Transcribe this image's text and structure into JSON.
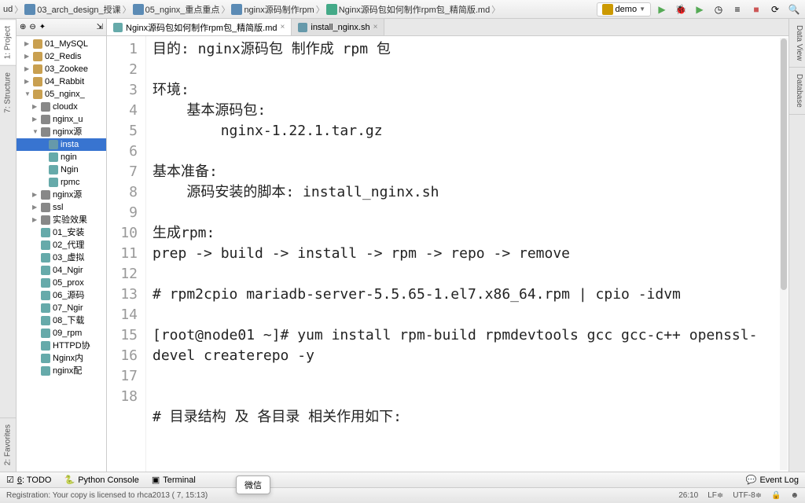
{
  "breadcrumb": [
    "ud",
    "03_arch_design_授课",
    "05_nginx_重点重点",
    "nginx源码制作rpm",
    "Nginx源码包如何制作rpm包_精简版.md"
  ],
  "run_config": "demo",
  "side_tabs": {
    "project": "1: Project",
    "structure": "7: Structure",
    "favorites": "2: Favorites"
  },
  "right_tabs": {
    "dataview": "Data View",
    "database": "Database"
  },
  "panel": {
    "header_icons": [
      "⊕",
      "⊖",
      "✦",
      "⇲"
    ]
  },
  "tree": [
    {
      "indent": 1,
      "arrow": "▶",
      "icon": "ti-folder",
      "label": "01_MySQL"
    },
    {
      "indent": 1,
      "arrow": "▶",
      "icon": "ti-folder",
      "label": "02_Redis"
    },
    {
      "indent": 1,
      "arrow": "▶",
      "icon": "ti-folder",
      "label": "03_Zookee"
    },
    {
      "indent": 1,
      "arrow": "▶",
      "icon": "ti-folder",
      "label": "04_Rabbit"
    },
    {
      "indent": 1,
      "arrow": "▼",
      "icon": "ti-folder",
      "label": "05_nginx_"
    },
    {
      "indent": 2,
      "arrow": "▶",
      "icon": "ti-folder-g",
      "label": "cloudx"
    },
    {
      "indent": 2,
      "arrow": "▶",
      "icon": "ti-folder-g",
      "label": "nginx_u"
    },
    {
      "indent": 2,
      "arrow": "▼",
      "icon": "ti-folder-g",
      "label": "nginx源"
    },
    {
      "indent": 3,
      "arrow": "",
      "icon": "ti-sh",
      "label": "insta",
      "sel": true
    },
    {
      "indent": 3,
      "arrow": "",
      "icon": "ti-md",
      "label": "ngin"
    },
    {
      "indent": 3,
      "arrow": "",
      "icon": "ti-md",
      "label": "Ngin"
    },
    {
      "indent": 3,
      "arrow": "",
      "icon": "ti-md",
      "label": "rpmc"
    },
    {
      "indent": 2,
      "arrow": "▶",
      "icon": "ti-folder-g",
      "label": "nginx源"
    },
    {
      "indent": 2,
      "arrow": "▶",
      "icon": "ti-folder-g",
      "label": "ssl"
    },
    {
      "indent": 2,
      "arrow": "▶",
      "icon": "ti-folder-g",
      "label": "实验效果"
    },
    {
      "indent": 2,
      "arrow": "",
      "icon": "ti-md",
      "label": "01_安装"
    },
    {
      "indent": 2,
      "arrow": "",
      "icon": "ti-md",
      "label": "02_代理"
    },
    {
      "indent": 2,
      "arrow": "",
      "icon": "ti-md",
      "label": "03_虚拟"
    },
    {
      "indent": 2,
      "arrow": "",
      "icon": "ti-md",
      "label": "04_Ngir"
    },
    {
      "indent": 2,
      "arrow": "",
      "icon": "ti-md",
      "label": "05_prox"
    },
    {
      "indent": 2,
      "arrow": "",
      "icon": "ti-md",
      "label": "06_源码"
    },
    {
      "indent": 2,
      "arrow": "",
      "icon": "ti-md",
      "label": "07_Ngir"
    },
    {
      "indent": 2,
      "arrow": "",
      "icon": "ti-md",
      "label": "08_下载"
    },
    {
      "indent": 2,
      "arrow": "",
      "icon": "ti-md",
      "label": "09_rpm"
    },
    {
      "indent": 2,
      "arrow": "",
      "icon": "ti-md",
      "label": "HTTPD协"
    },
    {
      "indent": 2,
      "arrow": "",
      "icon": "ti-md",
      "label": "Nginx内"
    },
    {
      "indent": 2,
      "arrow": "",
      "icon": "ti-md",
      "label": "nginx配"
    }
  ],
  "editor_tabs": [
    {
      "icon": "ti-md",
      "label": "Nginx源码包如何制作rpm包_精简版.md",
      "active": true
    },
    {
      "icon": "ti-sh",
      "label": "install_nginx.sh",
      "active": false
    }
  ],
  "gutter_lines": [
    "1",
    "2",
    "3",
    "4",
    "5",
    "6",
    "7",
    "8",
    "9",
    "10",
    "11",
    "12",
    "13",
    "",
    "14",
    "15",
    "",
    "16",
    "17",
    "18"
  ],
  "code_lines": [
    "目的: nginx源码包 制作成 rpm 包",
    "",
    "环境:",
    "    基本源码包:",
    "        nginx-1.22.1.tar.gz",
    "",
    "基本准备:",
    "    源码安装的脚本: install_nginx.sh",
    "",
    "生成rpm:",
    "prep -> build -> install -> rpm -> repo -> remove",
    "",
    "# rpm2cpio mariadb-server-5.5.65-1.el7.x86_64.rpm | cpio -idvm",
    "",
    "[root@node01 ~]# yum install rpm-build rpmdevtools gcc gcc-c++ openssl-devel createrepo -y",
    "",
    "",
    "# 目录结构 及 各目录 相关作用如下:"
  ],
  "bottom_tabs": [
    {
      "icon": "☑",
      "label": "6: TODO",
      "u": "6"
    },
    {
      "icon": "🐍",
      "label": "Python Console"
    },
    {
      "icon": "▣",
      "label": "Terminal"
    }
  ],
  "event_log": "Event Log",
  "status": {
    "msg": "Registration: Your copy is licensed to rhca2013 (             7, 15:13)",
    "pos": "26:10",
    "le": "LF≑",
    "enc": "UTF-8≑",
    "lock": "🔒",
    "face": "☻"
  },
  "popup": "微信"
}
